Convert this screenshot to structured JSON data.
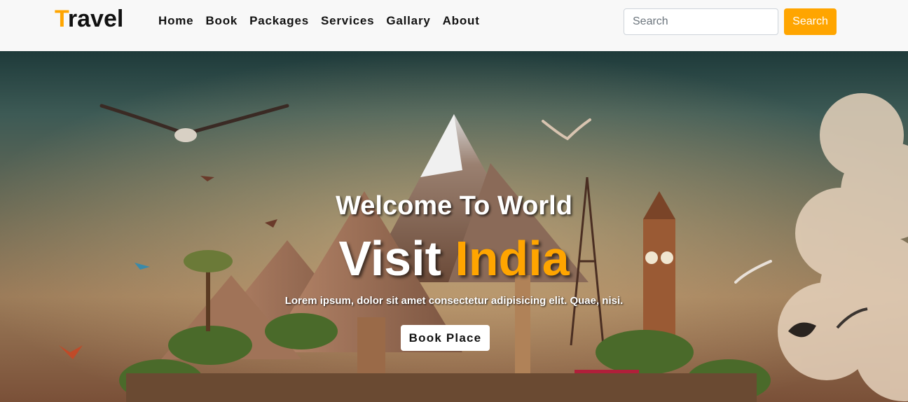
{
  "navbar": {
    "brand_first": "T",
    "brand_rest": "ravel",
    "links": [
      "Home",
      "Book",
      "Packages",
      "Services",
      "Gallary",
      "About"
    ],
    "search_placeholder": "Search",
    "search_button": "Search"
  },
  "hero": {
    "subtitle": "Welcome To World",
    "title_main": "Visit",
    "title_accent": "India",
    "description": "Lorem ipsum, dolor sit amet consectetur adipisicing elit. Quae, nisi.",
    "cta_label": "Book Place",
    "background_image": "travel-collage-illustration"
  },
  "colors": {
    "accent": "#ffa500",
    "navbar_bg": "#f8f8f8",
    "text_dark": "#111111"
  }
}
